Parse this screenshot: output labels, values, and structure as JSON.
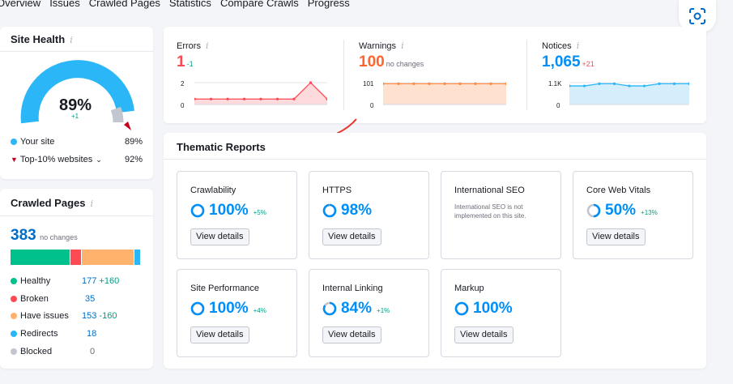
{
  "tabs": [
    "Overview",
    "Issues",
    "Crawled Pages",
    "Statistics",
    "Compare Crawls",
    "Progress"
  ],
  "site_health": {
    "title": "Site Health",
    "info": "i",
    "score": "89%",
    "score_change": "+1",
    "your_site_label": "Your site",
    "your_site_value": "89%",
    "top10_label": "Top-10% websites",
    "top10_value": "92%"
  },
  "metrics": {
    "errors": {
      "label": "Errors",
      "value": "1",
      "delta": "-1",
      "axis_top": "2",
      "axis_bottom": "0",
      "points": [
        0.25,
        0.25,
        0.25,
        0.25,
        0.25,
        0.25,
        0.25,
        1,
        0.25
      ]
    },
    "warnings": {
      "label": "Warnings",
      "value": "100",
      "delta": "no changes",
      "axis_top": "101",
      "axis_bottom": "0",
      "points": [
        0.95,
        0.95,
        0.95,
        0.95,
        0.95,
        0.95,
        0.95,
        0.95,
        0.95
      ]
    },
    "notices": {
      "label": "Notices",
      "value": "1,065",
      "delta": "+21",
      "axis_top": "1.1K",
      "axis_bottom": "0",
      "points": [
        0.85,
        0.85,
        0.95,
        0.95,
        0.85,
        0.85,
        0.95,
        0.95,
        0.95
      ]
    }
  },
  "thematic": {
    "title": "Thematic Reports",
    "reports": [
      {
        "name": "Crawlability",
        "score": "100%",
        "change": "+5%",
        "button": "View details"
      },
      {
        "name": "HTTPS",
        "score": "98%",
        "change": "",
        "button": "View details"
      },
      {
        "name": "International SEO",
        "note": "International SEO is not implemented on this site."
      },
      {
        "name": "Core Web Vitals",
        "score": "50%",
        "change": "+13%",
        "button": "View details"
      },
      {
        "name": "Site Performance",
        "score": "100%",
        "change": "+4%",
        "button": "View details"
      },
      {
        "name": "Internal Linking",
        "score": "84%",
        "change": "+1%",
        "button": "View details"
      },
      {
        "name": "Markup",
        "score": "100%",
        "change": "",
        "button": "View details"
      }
    ]
  },
  "crawled_pages": {
    "title": "Crawled Pages",
    "info": "i",
    "total": "383",
    "total_note": "no changes",
    "bar_fractions": [
      0.46,
      0.08,
      0.4,
      0.05
    ],
    "rows": [
      {
        "label": "Healthy",
        "value": "177",
        "delta": "+160",
        "color": "#00c08b"
      },
      {
        "label": "Broken",
        "value": "35",
        "delta": "",
        "color": "#ff4953"
      },
      {
        "label": "Have issues",
        "value": "153",
        "delta": "-160",
        "color": "#ffb26b"
      },
      {
        "label": "Redirects",
        "value": "18",
        "delta": "",
        "color": "#2bb7f7"
      },
      {
        "label": "Blocked",
        "value": "0",
        "delta": "",
        "color": "#c2c7cf"
      }
    ]
  },
  "colors": {
    "accent": "#008ff8",
    "error": "#ff4953",
    "warning": "#ff642d",
    "notice": "#008ff8",
    "positive": "#009f81"
  }
}
